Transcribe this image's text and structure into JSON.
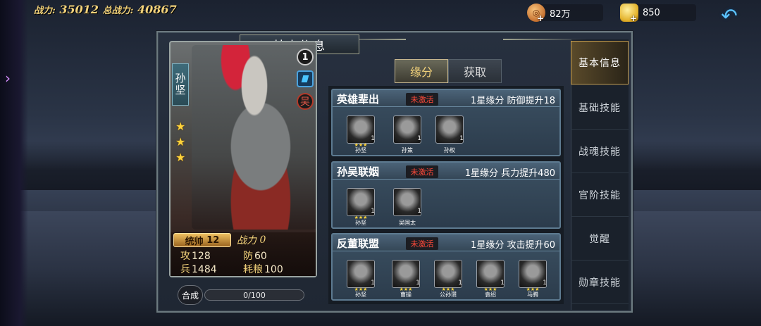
{
  "top": {
    "power_label": "战力:",
    "power_value": "35012",
    "total_power_label": "总战力:",
    "total_power_value": "40867",
    "coins": "82万",
    "gold": "850"
  },
  "panel": {
    "title": "基本信息"
  },
  "hero": {
    "name": "孙坚",
    "rank": "1",
    "faction": "吴",
    "stars": 3,
    "command_label": "统帅",
    "command_value": "12",
    "power_label": "战力",
    "power_value": "0",
    "attack_label": "攻",
    "attack_value": "128",
    "defense_label": "防",
    "defense_value": "60",
    "troops_label": "兵",
    "troops_value": "1484",
    "food_label": "耗粮",
    "food_value": "100",
    "synth_label": "合成",
    "synth_progress": "0/100"
  },
  "tabs": [
    {
      "label": "缘分",
      "active": true
    },
    {
      "label": "获取",
      "active": false
    }
  ],
  "bonds": [
    {
      "name": "英雄辈出",
      "status": "未激活",
      "effect": "1星缘分 防御提升18",
      "heroes": [
        {
          "name": "孙坚",
          "level": "1"
        },
        {
          "name": "孙策",
          "level": "1"
        },
        {
          "name": "孙权",
          "level": "1"
        }
      ]
    },
    {
      "name": "孙吴联姻",
      "status": "未激活",
      "effect": "1星缘分 兵力提升480",
      "heroes": [
        {
          "name": "孙坚",
          "level": "1"
        },
        {
          "name": "吴国太",
          "level": "1"
        }
      ]
    },
    {
      "name": "反董联盟",
      "status": "未激活",
      "effect": "1星缘分 攻击提升60",
      "heroes": [
        {
          "name": "孙坚",
          "level": "1"
        },
        {
          "name": "曹操",
          "level": "1"
        },
        {
          "name": "公孙瓒",
          "level": "1"
        },
        {
          "name": "袁绍",
          "level": "1"
        },
        {
          "name": "马腾",
          "level": "1"
        }
      ]
    }
  ],
  "side_tabs": [
    {
      "label": "基本信息",
      "active": true
    },
    {
      "label": "基础技能",
      "active": false
    },
    {
      "label": "战魂技能",
      "active": false
    },
    {
      "label": "官阶技能",
      "active": false
    },
    {
      "label": "觉醒",
      "active": false
    },
    {
      "label": "勋章技能",
      "active": false
    }
  ],
  "icons": {
    "back": "back-arrow-icon",
    "coin": "coin-icon",
    "gold": "gold-ingot-icon"
  }
}
